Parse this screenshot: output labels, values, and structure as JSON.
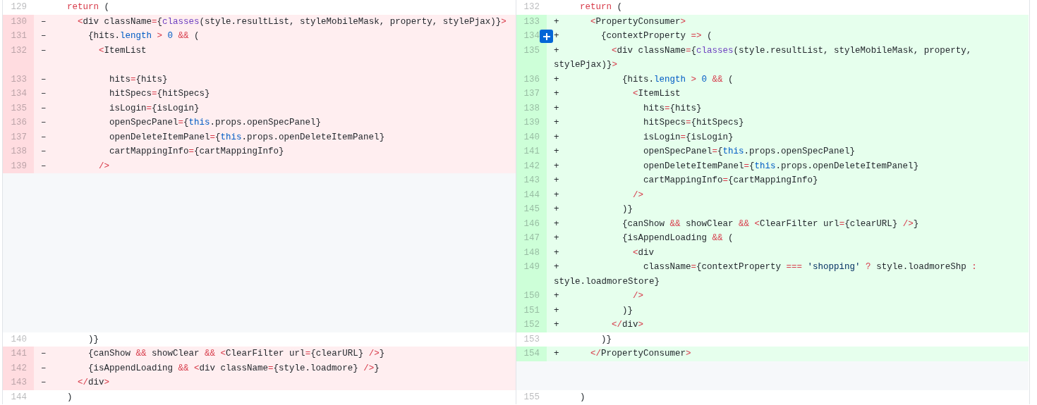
{
  "rows": [
    {
      "left": {
        "kind": "context",
        "number": "129",
        "code": [
          {
            "text": "  return",
            "kind": "keyword"
          },
          {
            "text": " ("
          }
        ]
      },
      "right": {
        "kind": "context",
        "number": "132",
        "code": [
          {
            "text": "  return",
            "kind": "keyword"
          },
          {
            "text": " ("
          }
        ]
      }
    },
    {
      "left": {
        "kind": "deletion",
        "number": "130",
        "sign": "–",
        "code": [
          {
            "text": "    <",
            "kind": "punct"
          },
          {
            "text": "div className"
          },
          {
            "text": "=",
            "kind": "punct"
          },
          {
            "text": "{"
          },
          {
            "text": "classes",
            "kind": "func"
          },
          {
            "text": "(style.resultList, styleMobileMask, property, stylePjax)}"
          },
          {
            "text": ">",
            "kind": "punct"
          }
        ]
      },
      "right": {
        "kind": "addition",
        "number": "133",
        "sign": "+",
        "code": [
          {
            "text": "    <",
            "kind": "punct"
          },
          {
            "text": "PropertyConsumer"
          },
          {
            "text": ">",
            "kind": "punct"
          }
        ]
      }
    },
    {
      "left": {
        "kind": "deletion",
        "number": "131",
        "sign": "–",
        "code": [
          {
            "text": "      {hits."
          },
          {
            "text": "length",
            "kind": "const"
          },
          {
            "text": " >",
            "kind": "punct"
          },
          {
            "text": " 0",
            "kind": "const"
          },
          {
            "text": " &&",
            "kind": "punct"
          },
          {
            "text": " ("
          }
        ]
      },
      "right": {
        "kind": "addition",
        "number": "134",
        "sign": "+",
        "comment_button": true,
        "code": [
          {
            "text": "      {contextProperty "
          },
          {
            "text": "=>",
            "kind": "punct"
          },
          {
            "text": " ("
          }
        ]
      }
    },
    {
      "left": {
        "kind": "deletion",
        "number": "132",
        "sign": "–",
        "code": [
          {
            "text": "        <",
            "kind": "punct"
          },
          {
            "text": "ItemList"
          }
        ]
      },
      "right": {
        "kind": "addition",
        "number": "135",
        "sign": "+",
        "code": [
          {
            "text": "        <",
            "kind": "punct"
          },
          {
            "text": "div className"
          },
          {
            "text": "=",
            "kind": "punct"
          },
          {
            "text": "{"
          },
          {
            "text": "classes",
            "kind": "func"
          },
          {
            "text": "(style.resultList, styleMobileMask, property, stylePjax)}"
          },
          {
            "text": ">",
            "kind": "punct"
          }
        ]
      }
    },
    {
      "left": {
        "kind": "deletion",
        "number": "133",
        "sign": "–",
        "code": [
          {
            "text": "          hits"
          },
          {
            "text": "=",
            "kind": "punct"
          },
          {
            "text": "{hits}"
          }
        ]
      },
      "right": {
        "kind": "addition",
        "number": "136",
        "sign": "+",
        "code": [
          {
            "text": "          {hits."
          },
          {
            "text": "length",
            "kind": "const"
          },
          {
            "text": " >",
            "kind": "punct"
          },
          {
            "text": " 0",
            "kind": "const"
          },
          {
            "text": " &&",
            "kind": "punct"
          },
          {
            "text": " ("
          }
        ]
      }
    },
    {
      "left": {
        "kind": "deletion",
        "number": "134",
        "sign": "–",
        "code": [
          {
            "text": "          hitSpecs"
          },
          {
            "text": "=",
            "kind": "punct"
          },
          {
            "text": "{hitSpecs}"
          }
        ]
      },
      "right": {
        "kind": "addition",
        "number": "137",
        "sign": "+",
        "code": [
          {
            "text": "            <",
            "kind": "punct"
          },
          {
            "text": "ItemList"
          }
        ]
      }
    },
    {
      "left": {
        "kind": "deletion",
        "number": "135",
        "sign": "–",
        "code": [
          {
            "text": "          isLogin"
          },
          {
            "text": "=",
            "kind": "punct"
          },
          {
            "text": "{isLogin}"
          }
        ]
      },
      "right": {
        "kind": "addition",
        "number": "138",
        "sign": "+",
        "code": [
          {
            "text": "              hits"
          },
          {
            "text": "=",
            "kind": "punct"
          },
          {
            "text": "{hits}"
          }
        ]
      }
    },
    {
      "left": {
        "kind": "deletion",
        "number": "136",
        "sign": "–",
        "code": [
          {
            "text": "          openSpecPanel"
          },
          {
            "text": "=",
            "kind": "punct"
          },
          {
            "text": "{"
          },
          {
            "text": "this",
            "kind": "const"
          },
          {
            "text": ".props.openSpecPanel}"
          }
        ]
      },
      "right": {
        "kind": "addition",
        "number": "139",
        "sign": "+",
        "code": [
          {
            "text": "              hitSpecs"
          },
          {
            "text": "=",
            "kind": "punct"
          },
          {
            "text": "{hitSpecs}"
          }
        ]
      }
    },
    {
      "left": {
        "kind": "deletion",
        "number": "137",
        "sign": "–",
        "code": [
          {
            "text": "          openDeleteItemPanel"
          },
          {
            "text": "=",
            "kind": "punct"
          },
          {
            "text": "{"
          },
          {
            "text": "this",
            "kind": "const"
          },
          {
            "text": ".props.openDeleteItemPanel}"
          }
        ]
      },
      "right": {
        "kind": "addition",
        "number": "140",
        "sign": "+",
        "code": [
          {
            "text": "              isLogin"
          },
          {
            "text": "=",
            "kind": "punct"
          },
          {
            "text": "{isLogin}"
          }
        ]
      }
    },
    {
      "left": {
        "kind": "deletion",
        "number": "138",
        "sign": "–",
        "code": [
          {
            "text": "          cartMappingInfo"
          },
          {
            "text": "=",
            "kind": "punct"
          },
          {
            "text": "{cartMappingInfo}"
          }
        ]
      },
      "right": {
        "kind": "addition",
        "number": "141",
        "sign": "+",
        "code": [
          {
            "text": "              openSpecPanel"
          },
          {
            "text": "=",
            "kind": "punct"
          },
          {
            "text": "{"
          },
          {
            "text": "this",
            "kind": "const"
          },
          {
            "text": ".props.openSpecPanel}"
          }
        ]
      }
    },
    {
      "left": {
        "kind": "deletion",
        "number": "139",
        "sign": "–",
        "code": [
          {
            "text": "        />",
            "kind": "punct"
          }
        ]
      },
      "right": {
        "kind": "addition",
        "number": "142",
        "sign": "+",
        "code": [
          {
            "text": "              openDeleteItemPanel"
          },
          {
            "text": "=",
            "kind": "punct"
          },
          {
            "text": "{"
          },
          {
            "text": "this",
            "kind": "const"
          },
          {
            "text": ".props.openDeleteItemPanel}"
          }
        ]
      }
    },
    {
      "left": {
        "kind": "empty"
      },
      "right": {
        "kind": "addition",
        "number": "143",
        "sign": "+",
        "code": [
          {
            "text": "              cartMappingInfo"
          },
          {
            "text": "=",
            "kind": "punct"
          },
          {
            "text": "{cartMappingInfo}"
          }
        ]
      }
    },
    {
      "left": {
        "kind": "empty"
      },
      "right": {
        "kind": "addition",
        "number": "144",
        "sign": "+",
        "code": [
          {
            "text": "            />",
            "kind": "punct"
          }
        ]
      }
    },
    {
      "left": {
        "kind": "empty"
      },
      "right": {
        "kind": "addition",
        "number": "145",
        "sign": "+",
        "code": [
          {
            "text": "          )}"
          }
        ]
      }
    },
    {
      "left": {
        "kind": "empty"
      },
      "right": {
        "kind": "addition",
        "number": "146",
        "sign": "+",
        "code": [
          {
            "text": "          {canShow "
          },
          {
            "text": "&&",
            "kind": "punct"
          },
          {
            "text": " showClear "
          },
          {
            "text": "&&",
            "kind": "punct"
          },
          {
            "text": " <",
            "kind": "punct"
          },
          {
            "text": "ClearFilter url"
          },
          {
            "text": "=",
            "kind": "punct"
          },
          {
            "text": "{clearURL} "
          },
          {
            "text": "/>",
            "kind": "punct"
          },
          {
            "text": "}"
          }
        ]
      }
    },
    {
      "left": {
        "kind": "empty"
      },
      "right": {
        "kind": "addition",
        "number": "147",
        "sign": "+",
        "code": [
          {
            "text": "          {isAppendLoading "
          },
          {
            "text": "&&",
            "kind": "punct"
          },
          {
            "text": " ("
          }
        ]
      }
    },
    {
      "left": {
        "kind": "empty"
      },
      "right": {
        "kind": "addition",
        "number": "148",
        "sign": "+",
        "code": [
          {
            "text": "            <",
            "kind": "punct"
          },
          {
            "text": "div"
          }
        ]
      }
    },
    {
      "left": {
        "kind": "empty"
      },
      "right": {
        "kind": "addition",
        "number": "149",
        "sign": "+",
        "code": [
          {
            "text": "              className"
          },
          {
            "text": "=",
            "kind": "punct"
          },
          {
            "text": "{contextProperty "
          },
          {
            "text": "===",
            "kind": "punct"
          },
          {
            "text": " 'shopping'",
            "kind": "string"
          },
          {
            "text": " ?",
            "kind": "punct"
          },
          {
            "text": " style.loadmoreShp "
          },
          {
            "text": ":",
            "kind": "punct"
          },
          {
            "text": " style.loadmoreStore}"
          }
        ]
      }
    },
    {
      "left": {
        "kind": "empty"
      },
      "right": {
        "kind": "addition",
        "number": "150",
        "sign": "+",
        "code": [
          {
            "text": "            />",
            "kind": "punct"
          }
        ]
      }
    },
    {
      "left": {
        "kind": "empty"
      },
      "right": {
        "kind": "addition",
        "number": "151",
        "sign": "+",
        "code": [
          {
            "text": "          )}"
          }
        ]
      }
    },
    {
      "left": {
        "kind": "empty"
      },
      "right": {
        "kind": "addition",
        "number": "152",
        "sign": "+",
        "code": [
          {
            "text": "        </",
            "kind": "punct"
          },
          {
            "text": "div"
          },
          {
            "text": ">",
            "kind": "punct"
          }
        ]
      }
    },
    {
      "left": {
        "kind": "context",
        "number": "140",
        "code": [
          {
            "text": "      )}"
          }
        ]
      },
      "right": {
        "kind": "context",
        "number": "153",
        "code": [
          {
            "text": "      )}"
          }
        ]
      }
    },
    {
      "left": {
        "kind": "deletion",
        "number": "141",
        "sign": "–",
        "code": [
          {
            "text": "      {canShow "
          },
          {
            "text": "&&",
            "kind": "punct"
          },
          {
            "text": " showClear "
          },
          {
            "text": "&&",
            "kind": "punct"
          },
          {
            "text": " <",
            "kind": "punct"
          },
          {
            "text": "ClearFilter url"
          },
          {
            "text": "=",
            "kind": "punct"
          },
          {
            "text": "{clearURL} "
          },
          {
            "text": "/>",
            "kind": "punct"
          },
          {
            "text": "}"
          }
        ]
      },
      "right": {
        "kind": "addition",
        "number": "154",
        "sign": "+",
        "code": [
          {
            "text": "    </",
            "kind": "punct"
          },
          {
            "text": "PropertyConsumer"
          },
          {
            "text": ">",
            "kind": "punct"
          }
        ]
      }
    },
    {
      "left": {
        "kind": "deletion",
        "number": "142",
        "sign": "–",
        "code": [
          {
            "text": "      {isAppendLoading "
          },
          {
            "text": "&&",
            "kind": "punct"
          },
          {
            "text": " <",
            "kind": "punct"
          },
          {
            "text": "div className"
          },
          {
            "text": "=",
            "kind": "punct"
          },
          {
            "text": "{style.loadmore} "
          },
          {
            "text": "/>",
            "kind": "punct"
          },
          {
            "text": "}"
          }
        ]
      },
      "right": {
        "kind": "empty"
      }
    },
    {
      "left": {
        "kind": "deletion",
        "number": "143",
        "sign": "–",
        "code": [
          {
            "text": "    </",
            "kind": "punct"
          },
          {
            "text": "div"
          },
          {
            "text": ">",
            "kind": "punct"
          }
        ]
      },
      "right": {
        "kind": "empty"
      }
    },
    {
      "left": {
        "kind": "context",
        "number": "144",
        "code": [
          {
            "text": "  )"
          }
        ]
      },
      "right": {
        "kind": "context",
        "number": "155",
        "code": [
          {
            "text": "  )"
          }
        ]
      }
    }
  ]
}
